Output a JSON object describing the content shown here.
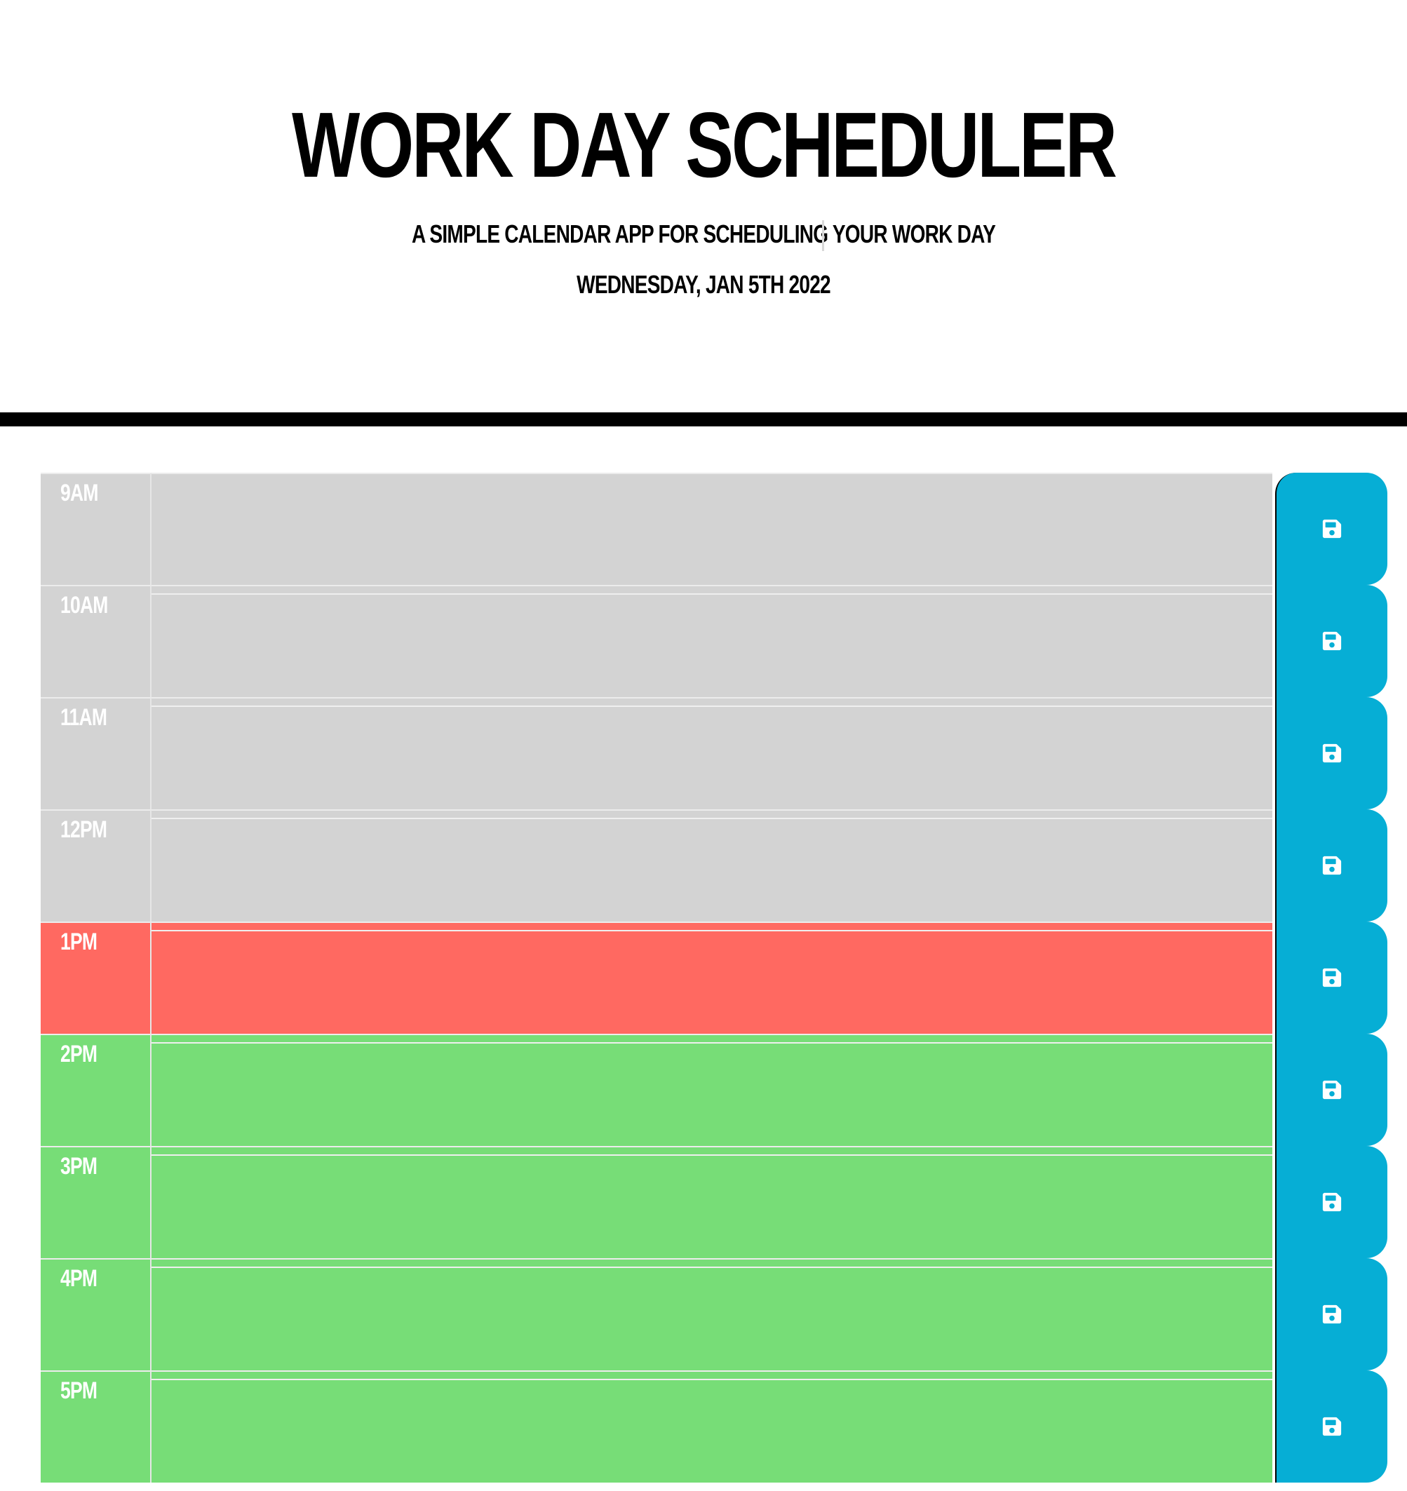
{
  "header": {
    "title": "Work Day Scheduler",
    "subtitle": "A simple calendar app for scheduling your work day",
    "current_date": "Wednesday, Jan 5th 2022"
  },
  "colors": {
    "past": "#d3d3d3",
    "present": "#ff6961",
    "future": "#77dd77",
    "save_button": "#06aed5"
  },
  "timeblocks": [
    {
      "hour": "9AM",
      "status": "past",
      "text": "",
      "save_icon": "save-icon"
    },
    {
      "hour": "10AM",
      "status": "past",
      "text": "",
      "save_icon": "save-icon"
    },
    {
      "hour": "11AM",
      "status": "past",
      "text": "",
      "save_icon": "save-icon"
    },
    {
      "hour": "12PM",
      "status": "past",
      "text": "",
      "save_icon": "save-icon"
    },
    {
      "hour": "1PM",
      "status": "present",
      "text": "",
      "save_icon": "save-icon"
    },
    {
      "hour": "2PM",
      "status": "future",
      "text": "",
      "save_icon": "save-icon"
    },
    {
      "hour": "3PM",
      "status": "future",
      "text": "",
      "save_icon": "save-icon"
    },
    {
      "hour": "4PM",
      "status": "future",
      "text": "",
      "save_icon": "save-icon"
    },
    {
      "hour": "5PM",
      "status": "future",
      "text": "",
      "save_icon": "save-icon"
    }
  ]
}
